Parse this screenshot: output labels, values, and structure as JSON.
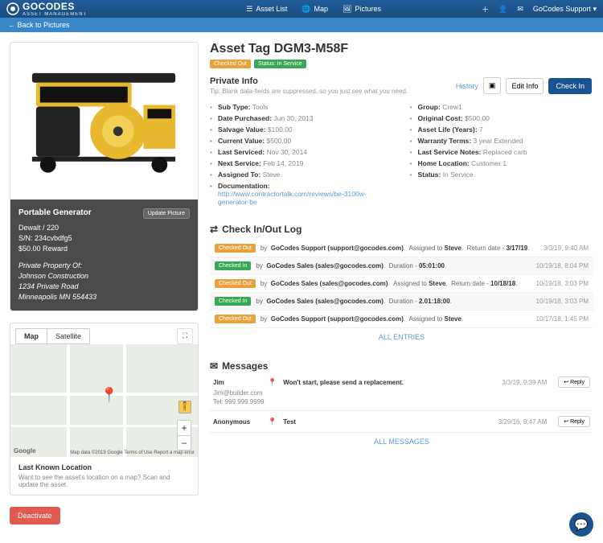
{
  "brand": {
    "name": "GOCODES",
    "sub": "ASSET MANAGEMENT"
  },
  "nav": {
    "assetList": "Asset List",
    "map": "Map",
    "pictures": "Pictures",
    "support": "GoCodes Support"
  },
  "back": {
    "label": "Back to Pictures"
  },
  "asset": {
    "nameLabel": "Portable Generator",
    "line1": "Dewalt / 220",
    "line2": "S/N: 234cvbdfg5",
    "line3": "$50.00 Reward",
    "propLabel": "Private Property Of:",
    "owner": "Johnson Construction",
    "addr1": "1234 Private Road",
    "addr2": "Minneapolis MN 554433",
    "updateBtn": "Update Picture"
  },
  "map": {
    "tabs": {
      "map": "Map",
      "sat": "Satellite"
    },
    "footTitle": "Last Known Location",
    "footDesc": "Want to see the asset's location on a map? Scan and update the asset.",
    "badge": "Google",
    "terms": "Map data ©2019 Google   Terms of Use   Report a map error"
  },
  "deactivate": "Deactivate",
  "header": {
    "title": "Asset Tag DGM3-M58F",
    "badges": {
      "checkedOut": "Checked Out",
      "status": "Status: In Service"
    },
    "actions": {
      "history": "History",
      "editInfo": "Edit Info",
      "checkIn": "Check In"
    }
  },
  "private": {
    "title": "Private Info",
    "tip": "Tip: Blank data-fields are suppressed, so you just see what you need.",
    "left": [
      {
        "k": "Sub Type:",
        "v": "Tools"
      },
      {
        "k": "Date Purchased:",
        "v": "Jun 30, 2013"
      },
      {
        "k": "Salvage Value:",
        "v": "$100.00"
      },
      {
        "k": "Current Value:",
        "v": "$500.00"
      },
      {
        "k": "Last Serviced:",
        "v": "Nov 30, 2014"
      },
      {
        "k": "Next Service:",
        "v": "Feb 14, 2019"
      },
      {
        "k": "Assigned To:",
        "v": "Steve"
      },
      {
        "k": "Documentation:",
        "v": "http://www.contractortalk.com/reviews/be-3100w-generator-be",
        "link": true
      }
    ],
    "right": [
      {
        "k": "Group:",
        "v": "Crew1"
      },
      {
        "k": "Original Cost:",
        "v": "$500.00"
      },
      {
        "k": "Asset Life (Years):",
        "v": "7"
      },
      {
        "k": "Warranty Terms:",
        "v": "3 year Extended"
      },
      {
        "k": "Last Service Notes:",
        "v": "Replaced carb"
      },
      {
        "k": "Home Location:",
        "v": "Customer 1"
      },
      {
        "k": "Status:",
        "v": "In Service"
      }
    ]
  },
  "log": {
    "title": "Check In/Out Log",
    "rows": [
      {
        "state": "Checked Out",
        "color": "orange",
        "who": "GoCodes Support (support@gocodes.com)",
        "extra": "Assigned to",
        "bold": "Steve",
        "ret": "Return date -",
        "date": "3/17/19",
        "ts": "3/3/19, 9:40 AM"
      },
      {
        "state": "Checked In",
        "color": "green",
        "who": "GoCodes Sales (sales@gocodes.com)",
        "extra": "Duration -",
        "bold": "05:01:00",
        "ret": "",
        "date": "",
        "ts": "10/19/18, 8:04 PM"
      },
      {
        "state": "Checked Out",
        "color": "orange",
        "who": "GoCodes Sales (sales@gocodes.com)",
        "extra": "Assigned to",
        "bold": "Steve",
        "ret": "Return date -",
        "date": "10/18/18",
        "ts": "10/19/18, 3:03 PM"
      },
      {
        "state": "Checked In",
        "color": "green",
        "who": "GoCodes Sales (sales@gocodes.com)",
        "extra": "Duration -",
        "bold": "2.01:18:00",
        "ret": "",
        "date": "",
        "ts": "10/19/18, 3:03 PM"
      },
      {
        "state": "Checked Out",
        "color": "orange",
        "who": "GoCodes Support (support@gocodes.com)",
        "extra": "Assigned to",
        "bold": "Steve",
        "ret": "",
        "date": "",
        "ts": "10/17/18, 1:45 PM"
      }
    ],
    "all": "ALL ENTRIES"
  },
  "messages": {
    "title": "Messages",
    "rows": [
      {
        "who": "Jim",
        "body": "Won't start, please send a replacement.",
        "ts": "3/3/19, 9:39 AM",
        "sub1": "Jim@builder.com",
        "sub2": "Tel: 999 999 9999"
      },
      {
        "who": "Anonymous",
        "body": "Test",
        "ts": "3/29/16, 9:47 AM"
      }
    ],
    "reply": "Reply",
    "all": "ALL MESSAGES"
  }
}
